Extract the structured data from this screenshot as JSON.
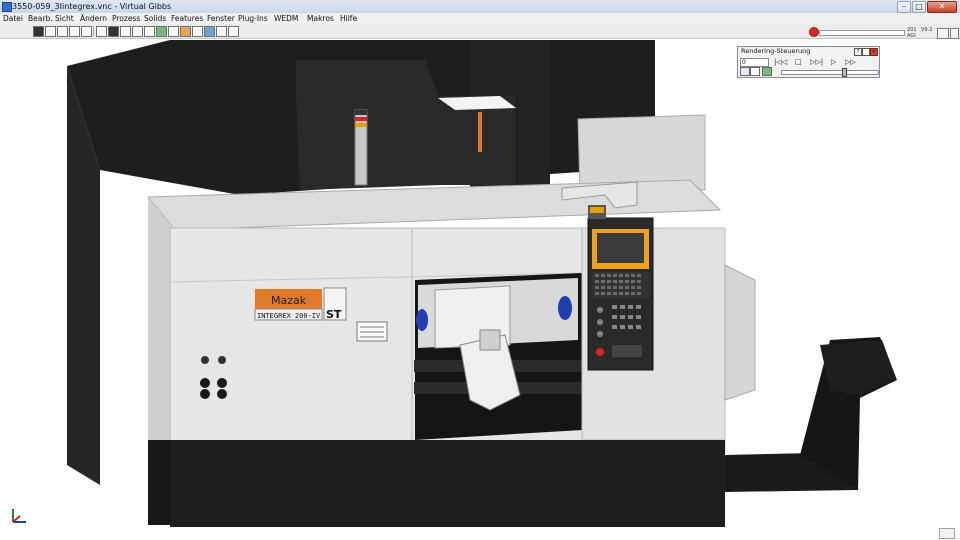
{
  "window": {
    "title": "3550-059_3Iintegrex.vnc - Virtual Gibbs",
    "minimize_glyph": "–",
    "maximize_glyph": "□",
    "close_glyph": "✕"
  },
  "menu": {
    "items": [
      "Datei",
      "Bearb.",
      "Sicht",
      "Ändern",
      "Prozess",
      "Solids",
      "Features",
      "Fenster",
      "Plug-Ins",
      "WEDM",
      "Makros",
      "Hilfe"
    ]
  },
  "toolbar": {
    "record_icon": "record-icon",
    "right_label_top": "201",
    "right_label_bottom": "AGI",
    "right_label_side": "V9.2"
  },
  "render_panel": {
    "title": "Rendering-Steuerung",
    "frame_value": "0",
    "controls": [
      "|◁◁",
      "□",
      "▷▷|",
      "▷",
      "▷▷"
    ],
    "help_glyph": "?",
    "close_glyph": "×"
  },
  "machine": {
    "brand": "Mazak",
    "model": "INTEGREX 200-IV",
    "model_suffix": "ST",
    "colors": {
      "housing": "#e6e6e6",
      "dark": "#1e1e1e",
      "brand_orange": "#e07a2a",
      "screen": "#f2a21a",
      "panel": "#2c2c2c"
    }
  }
}
